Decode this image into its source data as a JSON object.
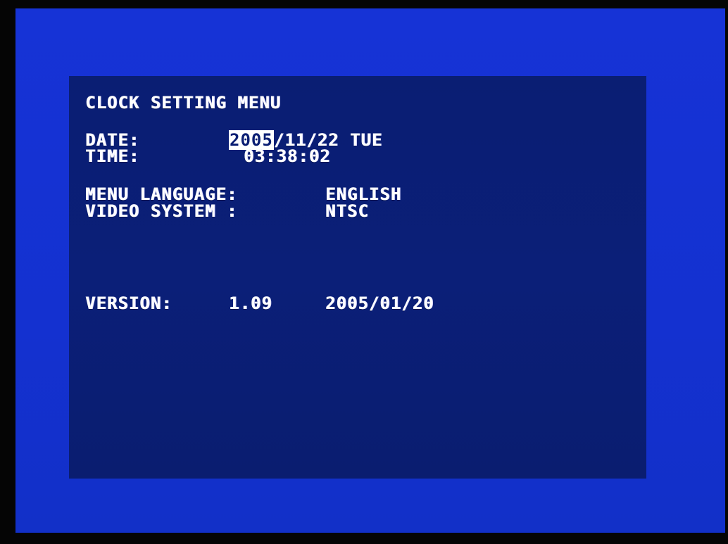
{
  "menu": {
    "title": "CLOCK SETTING MENU",
    "date": {
      "label": "DATE:",
      "year": "2005",
      "rest": "/11/22",
      "weekday": "TUE"
    },
    "time": {
      "label": "TIME:",
      "value": "03:38:02"
    },
    "language": {
      "label": "MENU LANGUAGE:",
      "value": "ENGLISH"
    },
    "video_system": {
      "label": "VIDEO SYSTEM :",
      "value": "NTSC"
    },
    "version": {
      "label": "VERSION:",
      "number": "1.09",
      "date": "2005/01/20"
    }
  },
  "colors": {
    "frame_blue": "#1431d0",
    "panel_navy": "#0b1f78",
    "text": "#ffffff",
    "outer": "#050505"
  }
}
